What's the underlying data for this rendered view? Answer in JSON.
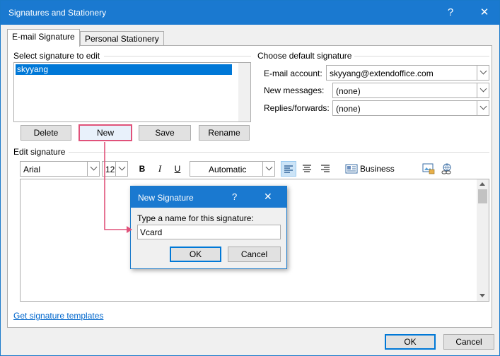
{
  "window": {
    "title": "Signatures and Stationery",
    "help_glyph": "?",
    "close_glyph": "✕"
  },
  "tabs": {
    "email_signature": "E-mail Signature",
    "personal_stationery": "Personal Stationery"
  },
  "select_section": {
    "label": "Select signature to edit",
    "items": [
      "skyyang"
    ],
    "buttons": {
      "delete": "Delete",
      "new": "New",
      "save": "Save",
      "rename": "Rename"
    }
  },
  "default_section": {
    "label": "Choose default signature",
    "email_account_label": "E-mail account:",
    "email_account_value": "skyyang@extendoffice.com",
    "new_messages_label": "New messages:",
    "new_messages_value": "(none)",
    "replies_label": "Replies/forwards:",
    "replies_value": "(none)"
  },
  "edit_section": {
    "label": "Edit signature",
    "font": "Arial",
    "size": "12",
    "bold": "B",
    "italic": "I",
    "underline": "U",
    "color": "Automatic",
    "business_card": "Business Card"
  },
  "footer": {
    "templates_link": "Get signature templates",
    "ok": "OK",
    "cancel": "Cancel"
  },
  "dialog": {
    "title": "New Signature",
    "help_glyph": "?",
    "close_glyph": "✕",
    "prompt": "Type a name for this signature:",
    "input_value": "Vcard",
    "ok": "OK",
    "cancel": "Cancel"
  },
  "colors": {
    "titlebar": "#1a79d0",
    "selection": "#0078d7",
    "callout": "#e0527a",
    "link": "#0066cc"
  }
}
